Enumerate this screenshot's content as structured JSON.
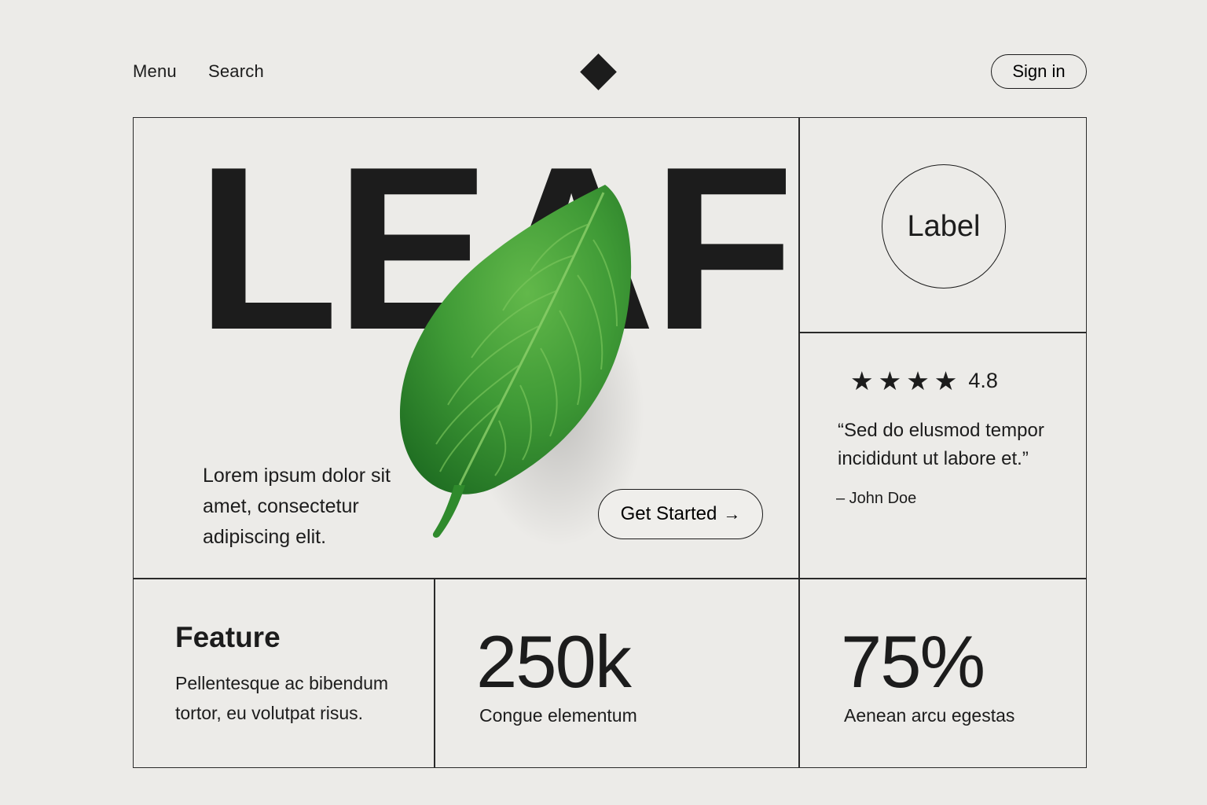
{
  "nav": {
    "menu_label": "Menu",
    "search_label": "Search",
    "signin_label": "Sign in"
  },
  "hero": {
    "title": "LEAF",
    "copy": "Lorem ipsum dolor sit amet, consectetur adipiscing elit.",
    "cta_label": "Get Started",
    "cta_icon": "arrow-right-icon",
    "image": "green-leaf-image"
  },
  "label_card": {
    "text": "Label"
  },
  "review": {
    "stars": 4,
    "rating": "4.8",
    "quote": "“Sed do elusmod tempor incididunt ut labore et.”",
    "author": "– John Doe"
  },
  "feature": {
    "title": "Feature",
    "text": "Pellentesque ac bibendum tortor, eu volutpat risus."
  },
  "stats": [
    {
      "value": "250k",
      "caption": "Congue elementum"
    },
    {
      "value": "75%",
      "caption": "Aenean arcu egestas"
    }
  ],
  "colors": {
    "background": "#ecebe8",
    "ink": "#1c1c1c",
    "leaf": "#3c9a36"
  }
}
